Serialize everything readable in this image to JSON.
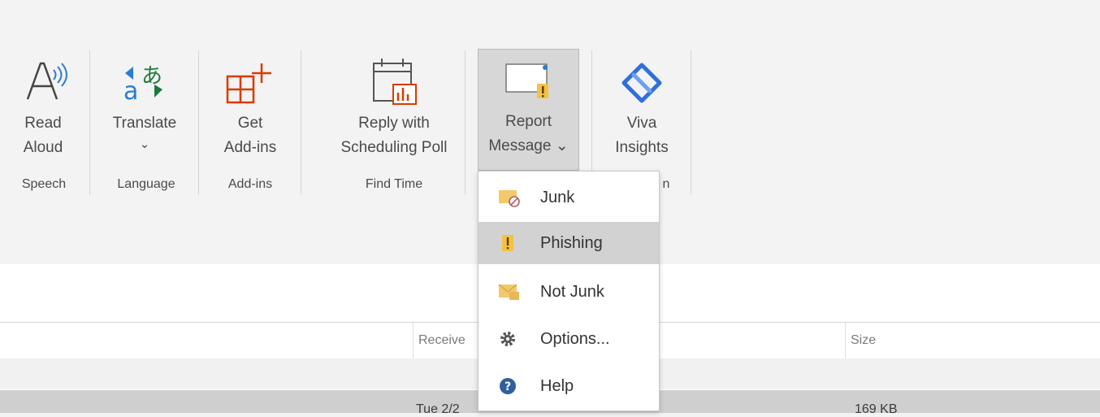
{
  "ribbon": {
    "read_aloud": {
      "line1": "Read",
      "line2": "Aloud"
    },
    "translate": {
      "line1": "Translate",
      "caret": "⌄"
    },
    "get_addins": {
      "line1": "Get",
      "line2": "Add-ins"
    },
    "reply_poll": {
      "line1": "Reply with",
      "line2": "Scheduling Poll"
    },
    "report_message": {
      "line1": "Report",
      "line2": "Message ⌄"
    },
    "viva": {
      "line1": "Viva",
      "line2": "Insights"
    },
    "groups": {
      "speech": "Speech",
      "language": "Language",
      "addins": "Add-ins",
      "find_time": "Find Time",
      "viva_partial": "n"
    }
  },
  "menu": {
    "items": [
      {
        "label": "Junk",
        "icon": "junk-envelope-icon"
      },
      {
        "label": "Phishing",
        "icon": "phishing-warning-icon"
      },
      {
        "label": "Not Junk",
        "icon": "not-junk-envelope-icon"
      },
      {
        "label": "Options...",
        "icon": "gear-icon"
      },
      {
        "label": "Help",
        "icon": "help-icon"
      }
    ],
    "highlighted_index": 1
  },
  "list": {
    "columns": {
      "received": "Receive",
      "size": "Size"
    },
    "row": {
      "received": "Tue 2/2",
      "size": "169 KB"
    }
  },
  "colors": {
    "accent_blue": "#2b7cd3",
    "addins_red": "#d83b01",
    "viva_blue": "#2f6fde",
    "warning_yellow": "#f4c243"
  }
}
